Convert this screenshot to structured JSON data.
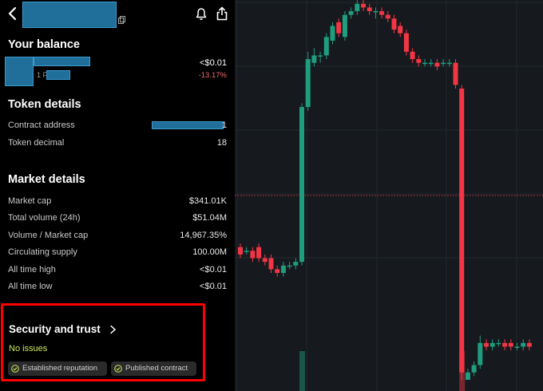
{
  "balance": {
    "title": "Your balance",
    "value": "<$0.01",
    "change": "-13.17%",
    "sub_label": "1 F"
  },
  "token_details": {
    "title": "Token details",
    "rows": [
      {
        "label": "Contract address",
        "value": "1"
      },
      {
        "label": "Token decimal",
        "value": "18"
      }
    ]
  },
  "market_details": {
    "title": "Market details",
    "rows": [
      {
        "label": "Market cap",
        "value": "$341.01K"
      },
      {
        "label": "Total volume (24h)",
        "value": "$51.04M"
      },
      {
        "label": "Volume / Market cap",
        "value": "14,967.35%"
      },
      {
        "label": "Circulating supply",
        "value": "100.00M"
      },
      {
        "label": "All time high",
        "value": "<$0.01"
      },
      {
        "label": "All time low",
        "value": "<$0.01"
      }
    ]
  },
  "security": {
    "title": "Security and trust",
    "status": "No issues",
    "badges": [
      "Established reputation",
      "Published contract"
    ]
  },
  "colors": {
    "up": "#1f9d7f",
    "down": "#f23645",
    "issues_ok": "#c8e85a",
    "chart_bg": "#161a1e",
    "highlight_box": "#ff0000"
  },
  "chart_data": {
    "type": "candlestick",
    "candles": [
      {
        "o": 0.36,
        "c": 0.34,
        "h": 0.37,
        "l": 0.33
      },
      {
        "o": 0.35,
        "c": 0.35,
        "h": 0.36,
        "l": 0.34
      },
      {
        "o": 0.35,
        "c": 0.33,
        "h": 0.36,
        "l": 0.32
      },
      {
        "o": 0.36,
        "c": 0.33,
        "h": 0.37,
        "l": 0.32
      },
      {
        "o": 0.33,
        "c": 0.32,
        "h": 0.34,
        "l": 0.31
      },
      {
        "o": 0.33,
        "c": 0.3,
        "h": 0.34,
        "l": 0.29
      },
      {
        "o": 0.3,
        "c": 0.29,
        "h": 0.31,
        "l": 0.28
      },
      {
        "o": 0.29,
        "c": 0.31,
        "h": 0.32,
        "l": 0.28
      },
      {
        "o": 0.31,
        "c": 0.31,
        "h": 0.32,
        "l": 0.3
      },
      {
        "o": 0.31,
        "c": 0.32,
        "h": 0.33,
        "l": 0.3
      },
      {
        "o": 0.32,
        "c": 0.74,
        "h": 0.75,
        "l": 0.31
      },
      {
        "o": 0.74,
        "c": 0.87,
        "h": 0.89,
        "l": 0.73
      },
      {
        "o": 0.86,
        "c": 0.88,
        "h": 0.9,
        "l": 0.85
      },
      {
        "o": 0.88,
        "c": 0.88,
        "h": 0.89,
        "l": 0.86
      },
      {
        "o": 0.88,
        "c": 0.93,
        "h": 0.94,
        "l": 0.87
      },
      {
        "o": 0.92,
        "c": 0.96,
        "h": 0.97,
        "l": 0.91
      },
      {
        "o": 0.97,
        "c": 0.94,
        "h": 0.98,
        "l": 0.93
      },
      {
        "o": 0.93,
        "c": 0.99,
        "h": 1.0,
        "l": 0.92
      },
      {
        "o": 0.99,
        "c": 1.0,
        "h": 1.01,
        "l": 0.98
      },
      {
        "o": 1.0,
        "c": 1.02,
        "h": 1.03,
        "l": 0.99
      },
      {
        "o": 1.02,
        "c": 1.01,
        "h": 1.03,
        "l": 1.0
      },
      {
        "o": 1.01,
        "c": 1.0,
        "h": 1.02,
        "l": 0.99
      },
      {
        "o": 1.0,
        "c": 1.0,
        "h": 1.01,
        "l": 0.98
      },
      {
        "o": 1.0,
        "c": 0.99,
        "h": 1.01,
        "l": 0.98
      },
      {
        "o": 0.99,
        "c": 0.98,
        "h": 1.0,
        "l": 0.97
      },
      {
        "o": 0.98,
        "c": 0.95,
        "h": 0.99,
        "l": 0.94
      },
      {
        "o": 0.96,
        "c": 0.94,
        "h": 0.97,
        "l": 0.93
      },
      {
        "o": 0.94,
        "c": 0.89,
        "h": 0.95,
        "l": 0.88
      },
      {
        "o": 0.89,
        "c": 0.87,
        "h": 0.9,
        "l": 0.86
      },
      {
        "o": 0.87,
        "c": 0.86,
        "h": 0.88,
        "l": 0.85
      },
      {
        "o": 0.86,
        "c": 0.86,
        "h": 0.87,
        "l": 0.85
      },
      {
        "o": 0.86,
        "c": 0.86,
        "h": 0.87,
        "l": 0.85
      },
      {
        "o": 0.86,
        "c": 0.85,
        "h": 0.87,
        "l": 0.84
      },
      {
        "o": 0.86,
        "c": 0.86,
        "h": 0.87,
        "l": 0.85
      },
      {
        "o": 0.86,
        "c": 0.86,
        "h": 0.87,
        "l": 0.85
      },
      {
        "o": 0.86,
        "c": 0.8,
        "h": 0.87,
        "l": 0.79
      },
      {
        "o": 0.79,
        "c": 0.02,
        "h": 0.8,
        "l": 0.0
      },
      {
        "o": 0.0,
        "c": 0.02,
        "h": 0.03,
        "l": 0.0
      },
      {
        "o": 0.02,
        "c": 0.04,
        "h": 0.05,
        "l": 0.01
      },
      {
        "o": 0.04,
        "c": 0.1,
        "h": 0.12,
        "l": 0.03
      },
      {
        "o": 0.1,
        "c": 0.09,
        "h": 0.11,
        "l": 0.08
      },
      {
        "o": 0.09,
        "c": 0.1,
        "h": 0.11,
        "l": 0.08
      },
      {
        "o": 0.1,
        "c": 0.1,
        "h": 0.11,
        "l": 0.09
      },
      {
        "o": 0.1,
        "c": 0.09,
        "h": 0.11,
        "l": 0.08
      },
      {
        "o": 0.1,
        "c": 0.09,
        "h": 0.11,
        "l": 0.08
      },
      {
        "o": 0.09,
        "c": 0.09,
        "h": 0.1,
        "l": 0.08
      },
      {
        "o": 0.09,
        "c": 0.1,
        "h": 0.11,
        "l": 0.08
      },
      {
        "o": 0.1,
        "c": 0.09,
        "h": 0.11,
        "l": 0.08
      }
    ],
    "current_price_level": 0.5,
    "grid": true
  }
}
